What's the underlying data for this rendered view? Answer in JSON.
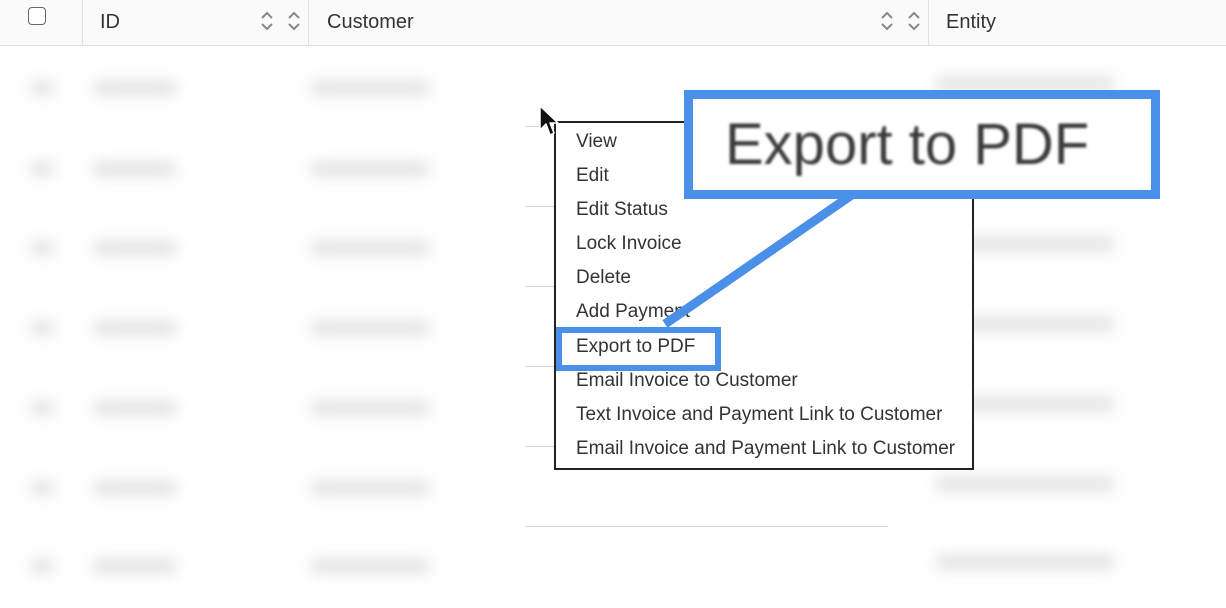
{
  "table": {
    "columns": [
      {
        "label": "ID"
      },
      {
        "label": "Customer"
      },
      {
        "label": "Entity"
      }
    ]
  },
  "context_menu": {
    "items": [
      "View",
      "Edit",
      "Edit Status",
      "Lock Invoice",
      "Delete",
      "Add Payment",
      "Export to PDF",
      "Email Invoice to Customer",
      "Text Invoice and Payment Link to Customer",
      "Email Invoice and Payment Link to Customer"
    ],
    "highlighted_index": 6
  },
  "callout": {
    "text": "Export to PDF"
  },
  "colors": {
    "highlight": "#4a8fe8",
    "menu_border": "#222222",
    "header_bg": "#fafafa"
  },
  "icons": {
    "select_all": "checkbox-icon",
    "sort": "sort-icon",
    "pointer": "mouse-cursor-icon"
  }
}
